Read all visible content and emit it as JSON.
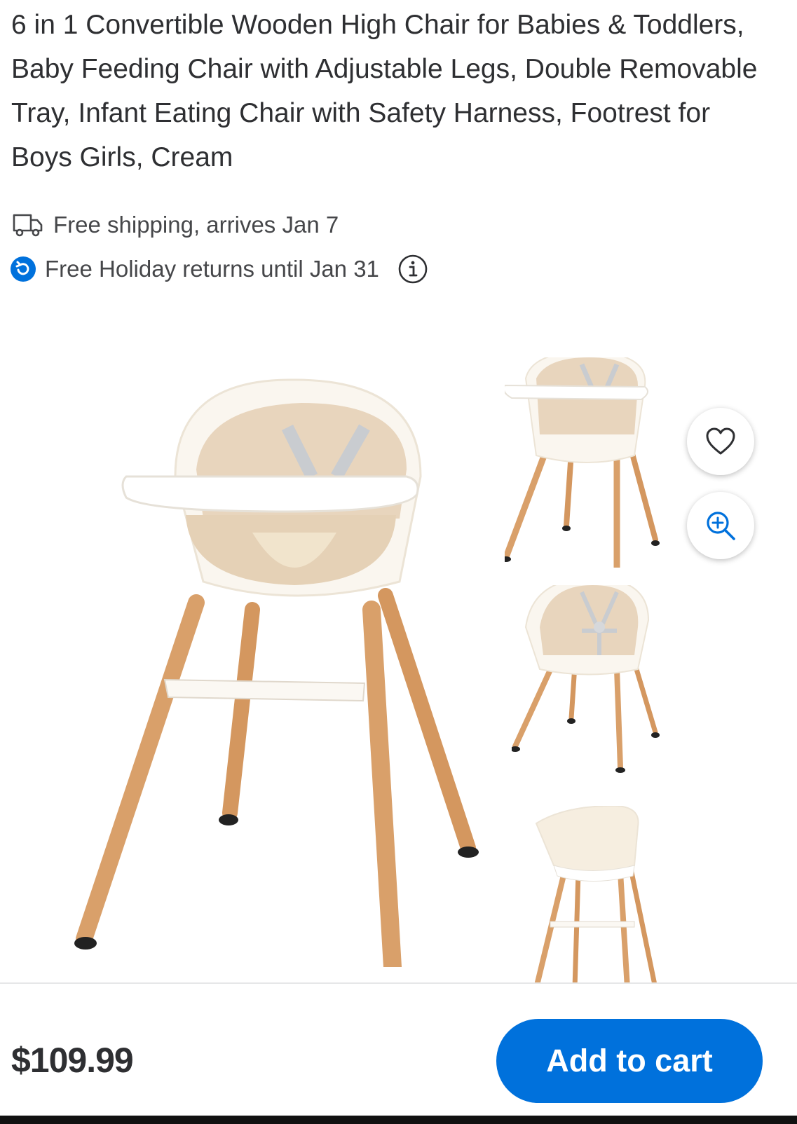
{
  "product": {
    "title": "6 in 1 Convertible Wooden High Chair for Babies & Toddlers, Baby Feeding Chair with Adjustable Legs, Double Removable Tray, Infant Eating Chair with Safety Harness, Footrest for Boys Girls, Cream",
    "shipping_text": "Free shipping, arrives Jan 7",
    "returns_text": "Free Holiday returns until Jan 31",
    "price": "$109.99"
  },
  "actions": {
    "add_to_cart_label": "Add to cart"
  },
  "icons": {
    "shipping": "truck-icon",
    "returns": "return-arrow-icon",
    "info": "info-icon",
    "favorite": "heart-icon",
    "zoom": "zoom-in-icon"
  },
  "colors": {
    "accent": "#0071dc",
    "text": "#2e2f32",
    "wood": "#d9a06a",
    "seat": "#e8d5bd"
  }
}
